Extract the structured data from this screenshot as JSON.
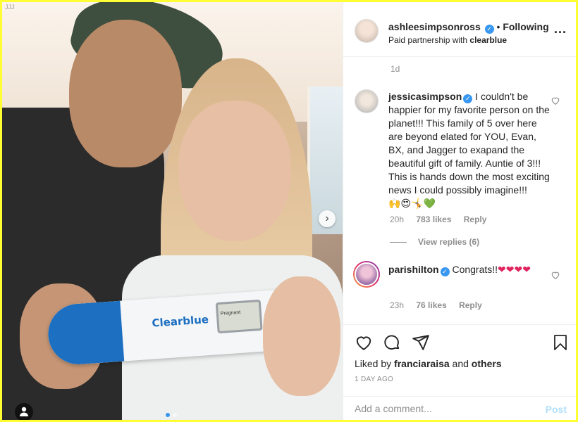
{
  "post": {
    "username": "ashleesimpsonross",
    "follow_status": "Following",
    "separator": "•",
    "paid_prefix": "Paid partnership with",
    "partner": "clearblue",
    "more": "...",
    "age": "1d"
  },
  "photo": {
    "watermark": "JJJ",
    "brand": "Clearblue",
    "screen_text": "Pregnant",
    "next_icon": "chevron-right-icon",
    "carousel_position": 1,
    "carousel_total": 2
  },
  "comments": [
    {
      "username": "jessicasimpson",
      "text": "I couldn't be happier for my favorite person on the planet!!! This family of 5 over here are beyond elated for YOU, Evan, BX, and Jagger to exapand the beautiful gift of family. Auntie of 3!!! This is hands down the most exciting news I could possibly imagine!!!",
      "emojis": "🙌😍🤸💚",
      "age": "20h",
      "likes": "783 likes",
      "reply": "Reply",
      "view_replies": "View replies (6)"
    },
    {
      "username": "parishilton",
      "text": "Congrats!!",
      "emojis": "❤❤❤❤",
      "age": "23h",
      "likes": "76 likes",
      "reply": "Reply"
    }
  ],
  "actions": {
    "liked_prefix": "Liked by",
    "liked_user": "franciaraisa",
    "liked_and": "and",
    "liked_others": "others",
    "date": "1 DAY AGO"
  },
  "comment_input": {
    "placeholder": "Add a comment...",
    "value": "",
    "post_label": "Post"
  },
  "colors": {
    "accent": "#3897f0",
    "post_disabled": "#b2dffc",
    "border_highlight": "#ffff33",
    "clearblue": "#1d6fc1"
  }
}
